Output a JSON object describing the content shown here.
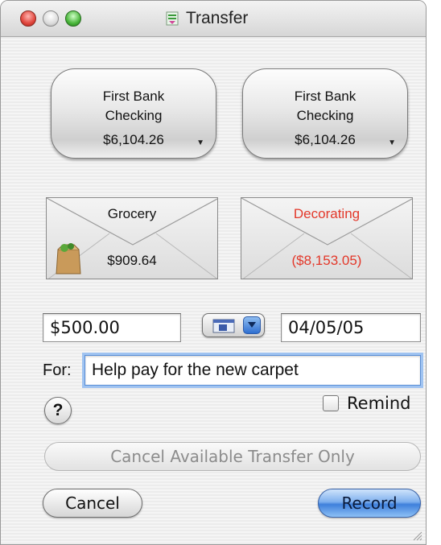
{
  "window": {
    "title": "Transfer"
  },
  "from_account": {
    "name_line1": "First Bank",
    "name_line2": "Checking",
    "balance": "$6,104.26"
  },
  "to_account": {
    "name_line1": "First Bank",
    "name_line2": "Checking",
    "balance": "$6,104.26"
  },
  "from_envelope": {
    "name": "Grocery",
    "balance": "$909.64",
    "icon": "grocery-bag-icon"
  },
  "to_envelope": {
    "name": "Decorating",
    "balance": "($8,153.05)",
    "color": "#e3382a"
  },
  "amount": {
    "value": "$500.00"
  },
  "date": {
    "value": "04/05/05"
  },
  "memo": {
    "label": "For:",
    "value": "Help pay for the new carpet"
  },
  "remind": {
    "label": "Remind",
    "checked": false
  },
  "buttons": {
    "help": "?",
    "cancel_available": "Cancel Available Transfer Only",
    "cancel": "Cancel",
    "record": "Record"
  },
  "colors": {
    "accent": "#3f80dc",
    "negative": "#e3382a"
  }
}
